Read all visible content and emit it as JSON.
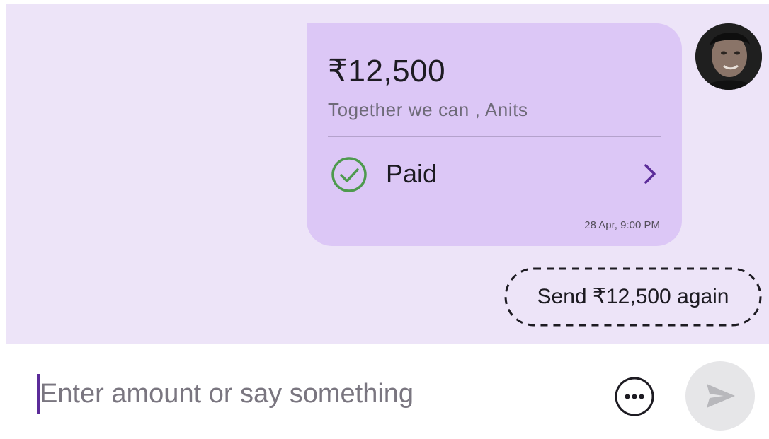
{
  "message": {
    "amount": "₹12,500",
    "note": "Together we can , Anits",
    "status": "Paid",
    "timestamp": "28 Apr, 9:00 PM",
    "status_color": "#4e9a4e",
    "bubble_color": "#dcc7f6",
    "accent_color": "#5b2b99"
  },
  "quick_action": {
    "label": "Send ₹12,500 again"
  },
  "composer": {
    "placeholder": "Enter amount or say something",
    "value": ""
  },
  "icons": {
    "avatar": "user-avatar",
    "status": "check-circle-icon",
    "details": "chevron-right-icon",
    "more": "more-horizontal-circle-icon",
    "send": "send-icon"
  },
  "colors": {
    "chat_background": "#ede4f8",
    "send_button_disabled": "#e6e6e8"
  }
}
